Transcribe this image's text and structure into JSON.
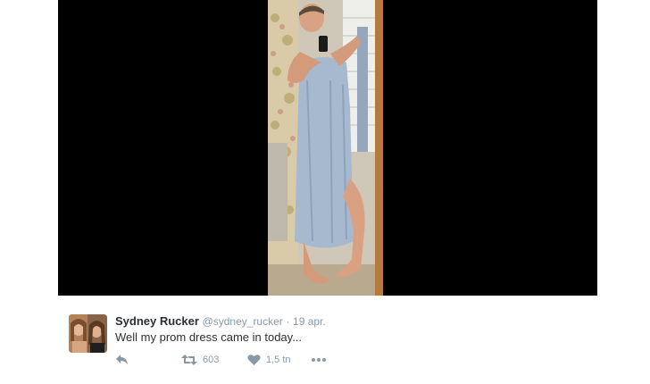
{
  "tweet": {
    "author_name": "Sydney Rucker",
    "handle": "@sydney_rucker",
    "separator": "·",
    "date": "19 apr.",
    "text": "Well my prom dress came in today...",
    "actions": {
      "retweet_count": "603",
      "like_count": "1,5 tn"
    }
  },
  "icons": {
    "reply": "reply-icon",
    "retweet": "retweet-icon",
    "like": "heart-icon",
    "more": "more-dots-icon"
  },
  "colors": {
    "name_text": "#292f33",
    "meta_text": "#8899a6",
    "media_background": "#000000"
  }
}
